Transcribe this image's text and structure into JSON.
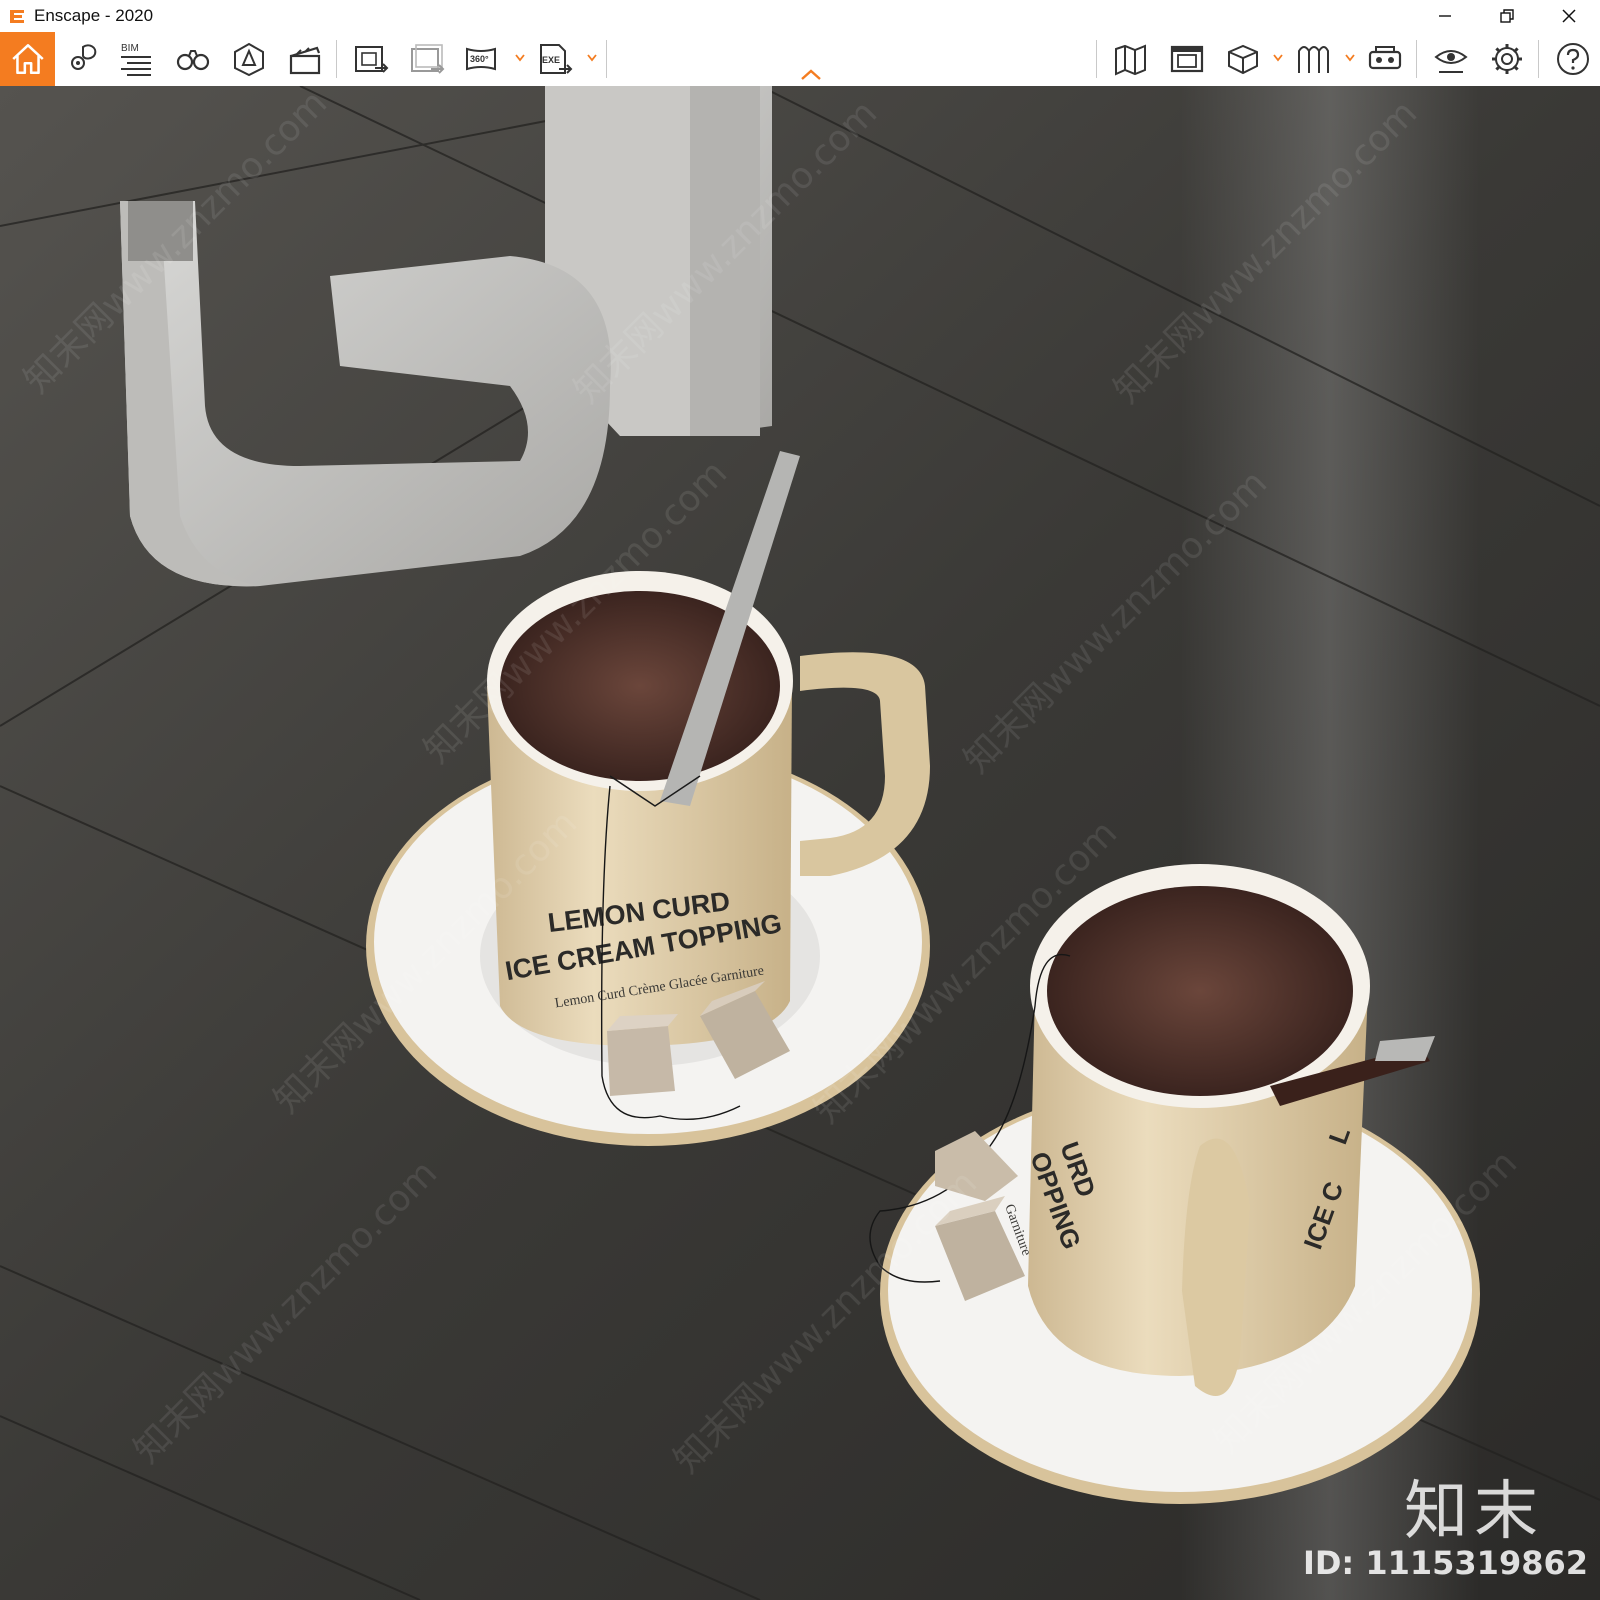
{
  "window": {
    "title": "Enscape - 2020",
    "controls": [
      "minimize-icon",
      "restore-icon",
      "close-icon"
    ]
  },
  "toolbar": {
    "accent": "#f47c20",
    "left_tools": [
      {
        "id": "home",
        "icon": "home-icon"
      },
      {
        "id": "location",
        "icon": "location-pin-icon"
      },
      {
        "id": "bim",
        "icon": "bim-icon",
        "label": "BIM"
      },
      {
        "id": "binoculars",
        "icon": "binoculars-icon"
      },
      {
        "id": "site",
        "icon": "site-context-icon"
      },
      {
        "id": "video",
        "icon": "clapperboard-icon"
      },
      {
        "id": "screenshot",
        "icon": "render-export-icon"
      },
      {
        "id": "batch",
        "icon": "batch-render-icon"
      },
      {
        "id": "pano",
        "icon": "panorama-360-icon",
        "label": "360°"
      },
      {
        "id": "exe",
        "icon": "exe-export-icon",
        "label": "EXE"
      }
    ],
    "right_tools": [
      {
        "id": "map",
        "icon": "map-icon"
      },
      {
        "id": "views",
        "icon": "views-icon"
      },
      {
        "id": "asset",
        "icon": "cube-icon"
      },
      {
        "id": "material",
        "icon": "material-editor-icon"
      },
      {
        "id": "vr",
        "icon": "vr-headset-icon"
      },
      {
        "id": "visual",
        "icon": "eye-settings-icon"
      },
      {
        "id": "settings",
        "icon": "gear-icon"
      },
      {
        "id": "help",
        "icon": "help-icon"
      }
    ]
  },
  "scene": {
    "floor_color": "#3a3936",
    "mug_color": "#e3d3b2",
    "tea_color": "#5b3a31",
    "saucer_color": "#f4f3f1",
    "mug1_text": {
      "line1": "LEMON CURD",
      "line2": "ICE CREAM TOPPING",
      "line3": "Lemon Curd Crème Glacée Garniture"
    },
    "mug2_text": {
      "line1": "URD",
      "line2": "OPPING",
      "line3": "Garniture",
      "line4": "L",
      "line5": "ICE C"
    }
  },
  "watermark": {
    "brand": "知末",
    "id": "ID: 1115319862",
    "tile": "知末网www.znzmo.com"
  }
}
